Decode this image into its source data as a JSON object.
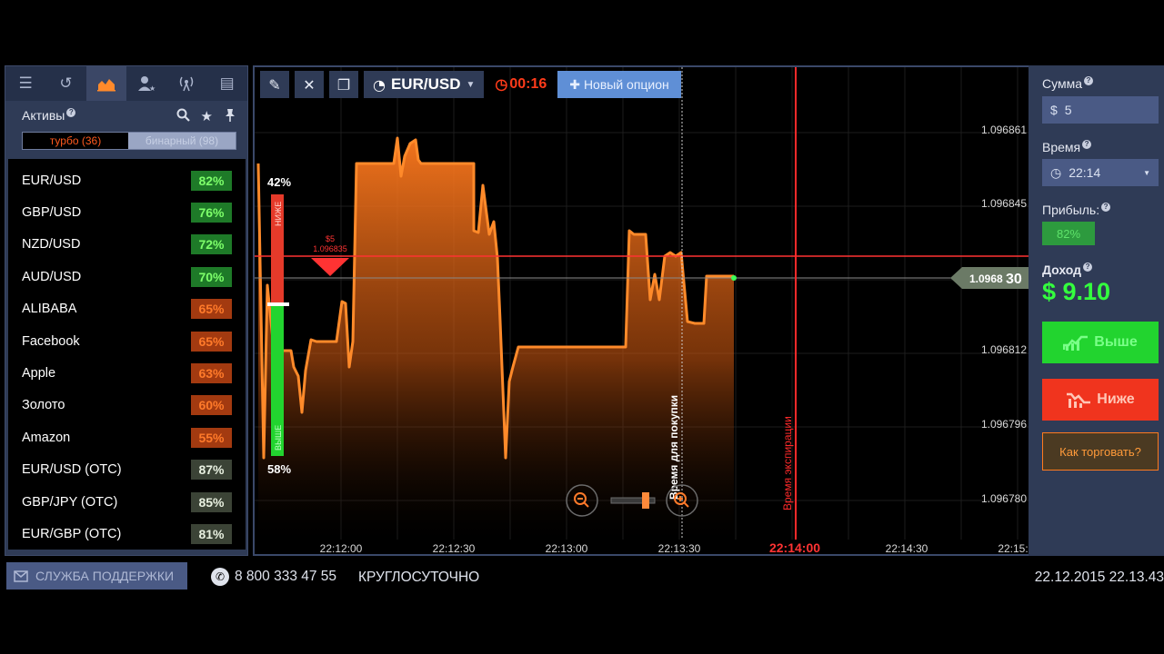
{
  "left_panel": {
    "tabs": [
      {
        "name": "menu-icon",
        "glyph": "☰"
      },
      {
        "name": "history-icon",
        "glyph": "↺"
      },
      {
        "name": "chart-icon",
        "glyph": "▟"
      },
      {
        "name": "users-icon",
        "glyph": "♣"
      },
      {
        "name": "signal-icon",
        "glyph": "⚲"
      },
      {
        "name": "news-icon",
        "glyph": "▤"
      }
    ],
    "assets_title": "Активы",
    "help": "?",
    "tools": {
      "search": "🔍",
      "favorite": "★",
      "pin": "📌"
    },
    "turbo_label": "турбо (36)",
    "binary_label": "бинарный (98)",
    "assets": [
      {
        "name": "EUR/USD",
        "pct": "82%",
        "tone": "green"
      },
      {
        "name": "GBP/USD",
        "pct": "76%",
        "tone": "green"
      },
      {
        "name": "NZD/USD",
        "pct": "72%",
        "tone": "green"
      },
      {
        "name": "AUD/USD",
        "pct": "70%",
        "tone": "green"
      },
      {
        "name": "ALIBABA",
        "pct": "65%",
        "tone": "orange"
      },
      {
        "name": "Facebook",
        "pct": "65%",
        "tone": "orange"
      },
      {
        "name": "Apple",
        "pct": "63%",
        "tone": "orange"
      },
      {
        "name": "Золото",
        "pct": "60%",
        "tone": "orange"
      },
      {
        "name": "Amazon",
        "pct": "55%",
        "tone": "orange"
      },
      {
        "name": "EUR/USD (OTC)",
        "pct": "87%",
        "tone": "gray"
      },
      {
        "name": "GBP/JPY (OTC)",
        "pct": "85%",
        "tone": "gray"
      },
      {
        "name": "EUR/GBP (OTC)",
        "pct": "81%",
        "tone": "gray"
      }
    ]
  },
  "toolbar": {
    "pair": "EUR/USD",
    "timer": "00:16",
    "new_option": "Новый опцион"
  },
  "chart_data": {
    "type": "area",
    "x_ticks": [
      "22:12:00",
      "22:12:30",
      "22:13:00",
      "22:13:30",
      "22:14:00",
      "22:14:30",
      "22:15:"
    ],
    "y_ticks": [
      "1.096861",
      "1.096845",
      "1.096812",
      "1.096796",
      "1.096780"
    ],
    "current_price": "1.0968",
    "current_price_suffix": "30",
    "open_marker": {
      "amount": "$5",
      "price": "1.096835"
    },
    "sentiment": {
      "up_pct": "42%",
      "down_pct": "58%",
      "up_label": "НИЖЕ",
      "down_label": "ВЫШЕ",
      "up_fraction": 0.42
    },
    "purchase_time_label": "Время для покупки",
    "expiry_label": "Время экспирации",
    "expiry_time": "22:14:00",
    "colors": {
      "area": "#ff7a1e",
      "expiry": "#ff2a2a",
      "price_line": "#ff3333"
    }
  },
  "right_panel": {
    "amount_label": "Сумма",
    "amount_currency": "$",
    "amount_value": "5",
    "time_label": "Время",
    "time_value": "22:14",
    "profit_label": "Прибыль:",
    "profit_value": "82%",
    "income_label": "Доход",
    "income_value": "$ 9.10",
    "up_button": "Выше",
    "down_button": "Ниже",
    "howto_button": "Как торговать?"
  },
  "footer": {
    "support": "СЛУЖБА ПОДДЕРЖКИ",
    "phone": "8 800 333 47 55",
    "hours": "КРУГЛОСУТОЧНО",
    "datetime": "22.12.2015 22.13.43"
  }
}
